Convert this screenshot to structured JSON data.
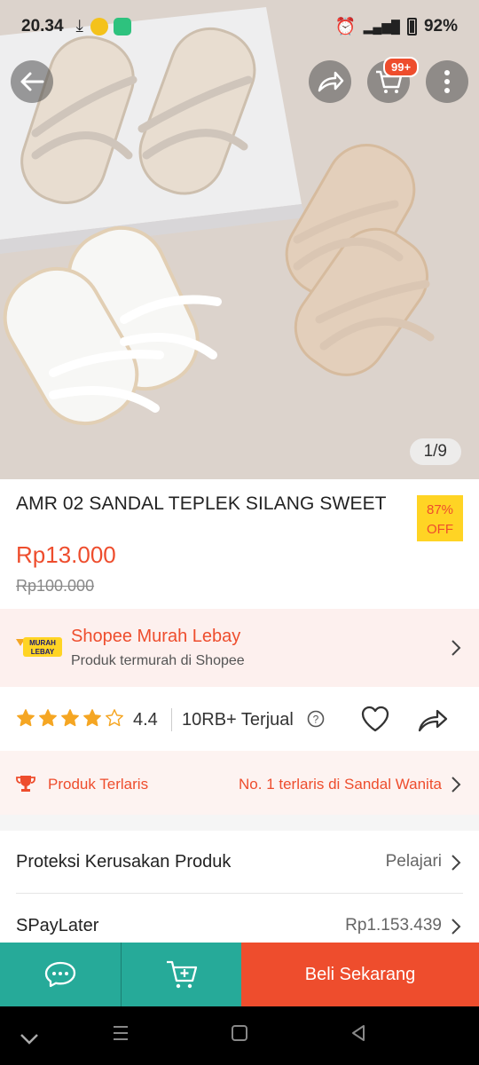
{
  "status": {
    "time": "20.34",
    "battery": "92%"
  },
  "gallery": {
    "counter": "1/9",
    "cart_badge": "99+"
  },
  "product": {
    "title": "AMR 02 SANDAL TEPLEK SILANG SWEET",
    "discount_line1": "87%",
    "discount_line2": "OFF",
    "price": "Rp13.000",
    "old_price": "Rp100.000"
  },
  "promo": {
    "logo_text": "MURAH LEBAY",
    "title": "Shopee Murah Lebay",
    "subtitle": "Produk termurah di Shopee"
  },
  "rating": {
    "value": "4.4",
    "stars_filled": 4,
    "sold": "10RB+ Terjual"
  },
  "bestseller": {
    "label": "Produk Terlaris",
    "info": "No. 1 terlaris di Sandal Wanita"
  },
  "rows": [
    {
      "label": "Proteksi Kerusakan Produk",
      "value": "Pelajari"
    },
    {
      "label": "SPayLater",
      "value": "Rp1.153.439"
    }
  ],
  "bottom": {
    "buy_label": "Beli Sekarang"
  },
  "colors": {
    "brand": "#ee4d2d",
    "teal": "#26aa99",
    "star": "#f5a623"
  },
  "icons": [
    "back-icon",
    "share-icon",
    "cart-icon",
    "more-icon",
    "help-icon",
    "heart-icon",
    "chat-icon",
    "add-to-cart-icon",
    "trophy-icon",
    "chevron-right-icon"
  ]
}
